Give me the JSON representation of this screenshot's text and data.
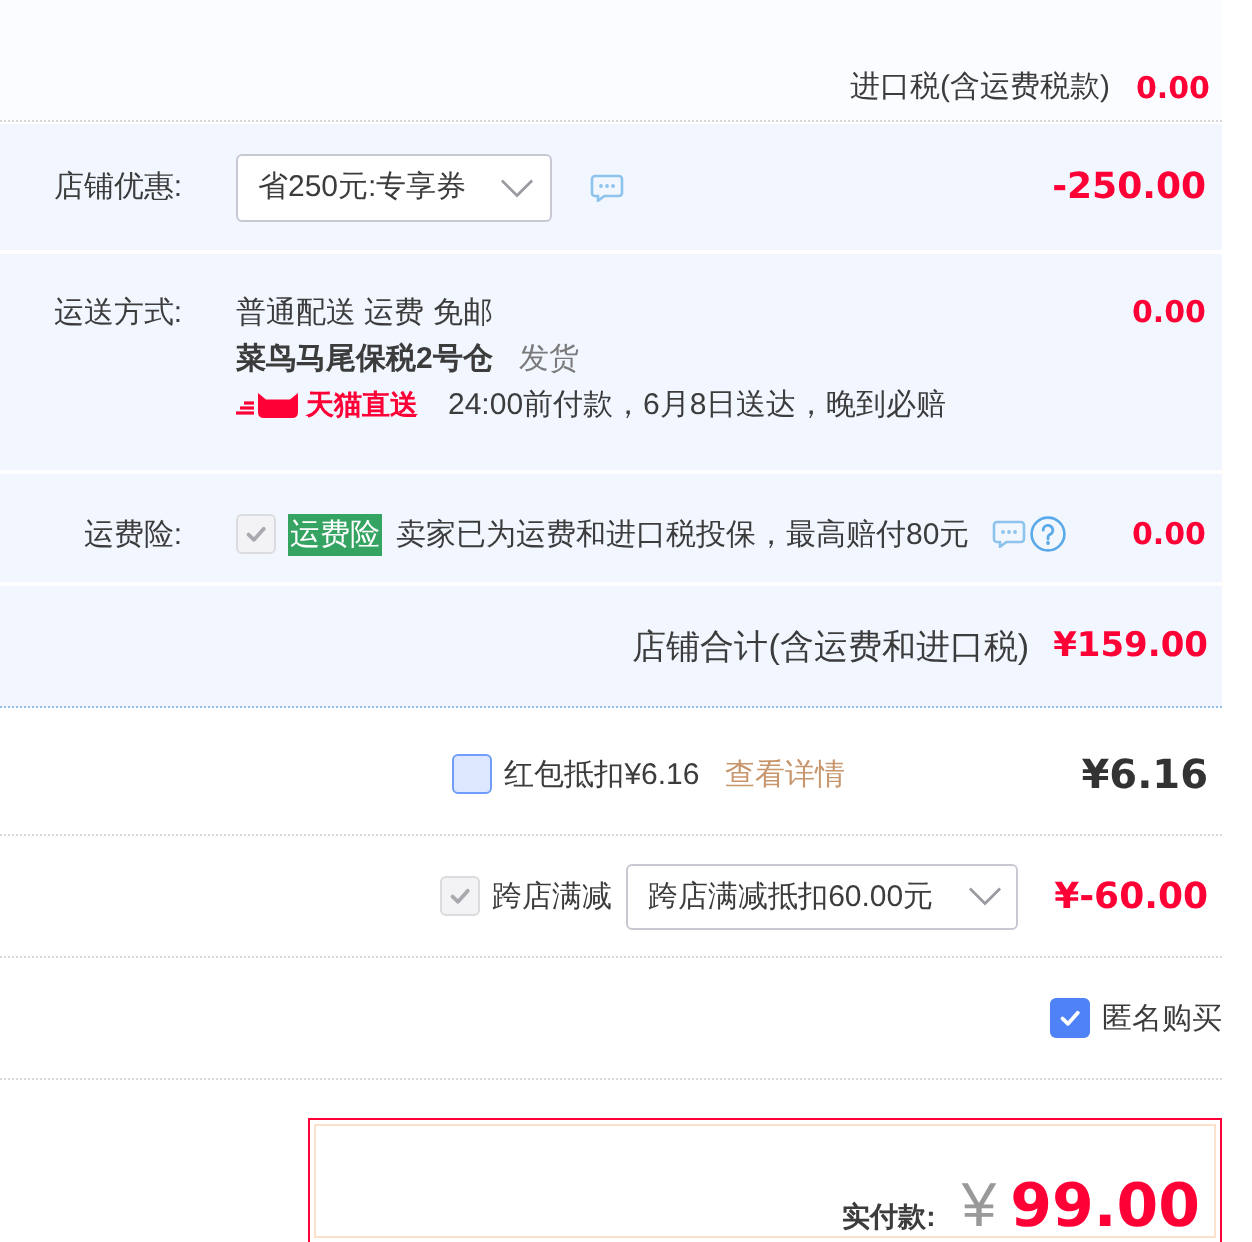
{
  "import_tax": {
    "label": "进口税(含运费税款)",
    "amount": "0.00"
  },
  "shop": {
    "discount": {
      "label": "店铺优惠:",
      "select": {
        "value": "省250元:专享券"
      },
      "amount": "-250.00"
    },
    "shipping": {
      "label": "运送方式:",
      "method": "普通配送 运费 免邮",
      "warehouse": "菜鸟马尾保税2号仓",
      "dispatch": "发货",
      "service": "天猫直送",
      "promise": "24:00前付款，6月8日送达，晚到必赔",
      "amount": "0.00"
    },
    "insurance": {
      "label": "运费险:",
      "checkbox": {
        "checked": true,
        "disabled": true
      },
      "tag": "运费险",
      "text": "卖家已为运费和进口税投保，最高赔付80元",
      "amount": "0.00"
    },
    "total": {
      "label": "店铺合计(含运费和进口税)",
      "amount": "¥159.00"
    }
  },
  "red_packet": {
    "checkbox": {
      "checked": false,
      "disabled": false
    },
    "label": "红包抵扣¥6.16",
    "link": "查看详情",
    "amount": "¥6.16"
  },
  "cross_store": {
    "checkbox": {
      "checked": true,
      "disabled": true
    },
    "label": "跨店满减",
    "select": {
      "value": "跨店满减抵扣60.00元"
    },
    "amount": "¥-60.00"
  },
  "anonymous": {
    "checkbox": {
      "checked": true,
      "disabled": false
    },
    "label": "匿名购买"
  },
  "payment": {
    "label": "实付款:",
    "currency": "¥",
    "amount": "99.00"
  }
}
